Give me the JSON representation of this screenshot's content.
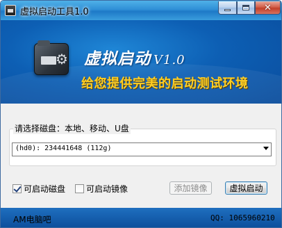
{
  "window": {
    "title": "虚拟启动工具1.0",
    "controls": {
      "minimize": "minimize-icon",
      "maximize": "maximize-icon",
      "close": "close-icon"
    }
  },
  "banner": {
    "title": "虚拟启动",
    "version": "V1.0",
    "subtitle": "给您提供完美的启动测试环境",
    "icon": "disk-gear-icon",
    "colors": {
      "background": "#0d5fb4",
      "title": "#ffffff",
      "subtitle": "#ffcf24"
    }
  },
  "disk_group": {
    "label": "请选择磁盘：本地、移动、U盘",
    "selected_disk": "(hd0): 234441648 (112g)"
  },
  "options": {
    "bootable_disk": {
      "label": "可启动磁盘",
      "checked": true
    },
    "bootable_image": {
      "label": "可启动镜像",
      "checked": false
    }
  },
  "buttons": {
    "add_image": {
      "label": "添加镜像",
      "enabled": false
    },
    "virtual_boot": {
      "label": "虚拟启动",
      "enabled": true
    }
  },
  "status": {
    "left": "AM电脑吧",
    "right": "QQ: 1065960210"
  }
}
